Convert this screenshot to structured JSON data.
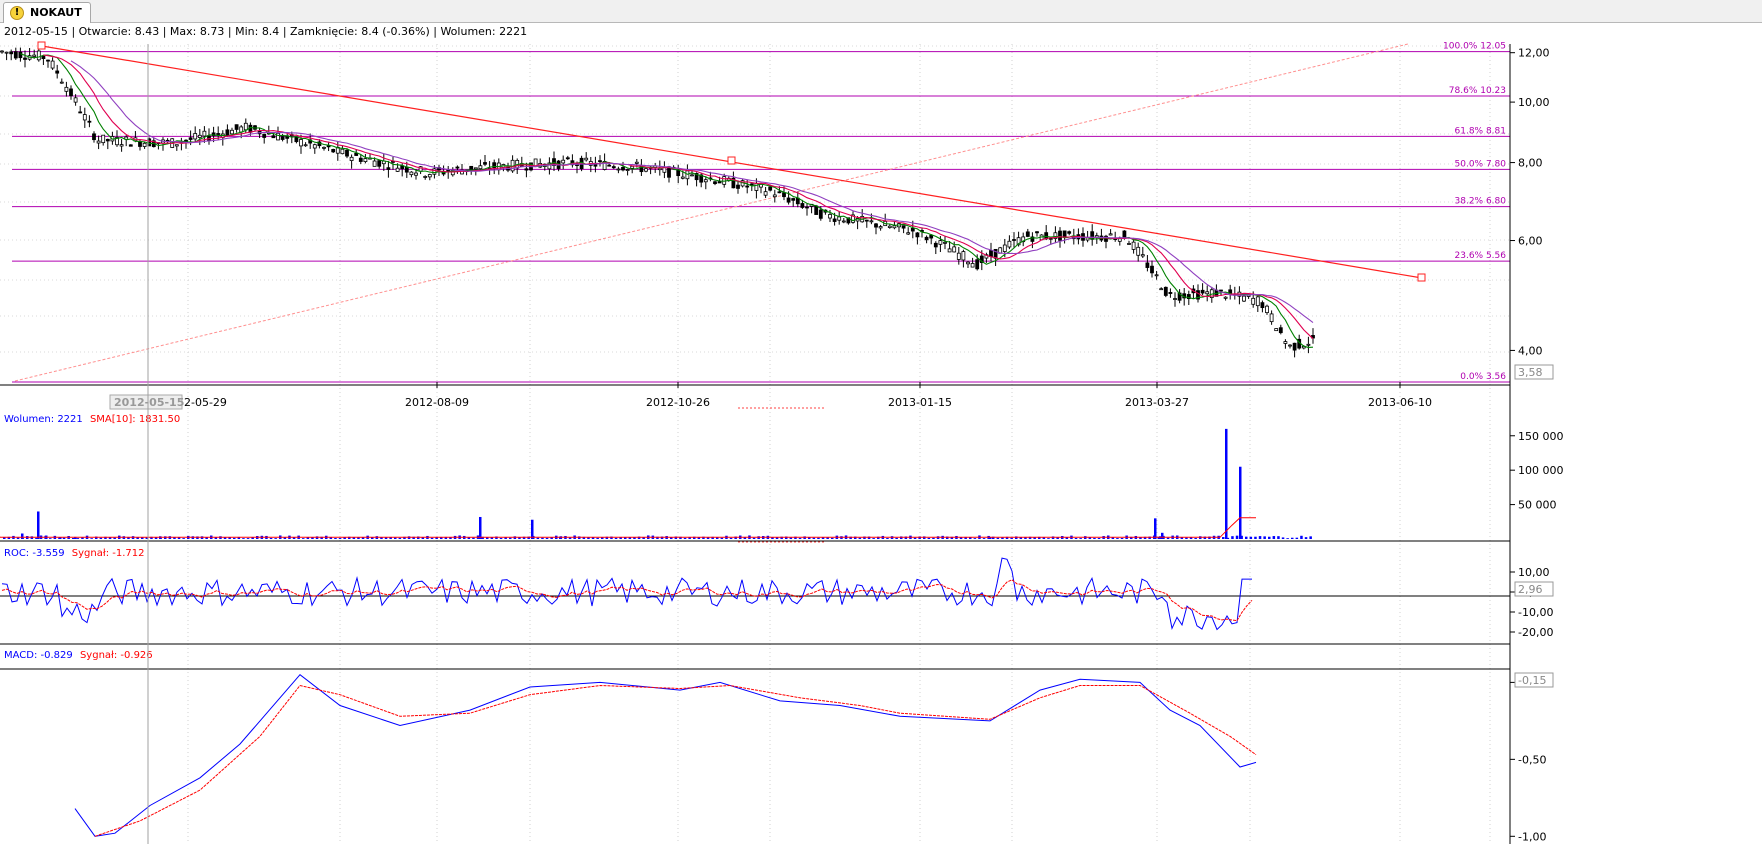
{
  "tab": {
    "label": "NOKAUT",
    "icon": "warning-icon"
  },
  "info": {
    "date": "2012-05-15",
    "open_label": "Otwarcie",
    "open": "8.43",
    "max_label": "Max",
    "max": "8.73",
    "min_label": "Min",
    "min": "8.4",
    "close_label": "Zamknięcie",
    "close": "8.4 (-0.36%)",
    "volume_label": "Wolumen",
    "volume": "2221"
  },
  "fibonacci": [
    {
      "label": "100.0% 12.05",
      "value": 12.05
    },
    {
      "label": "78.6% 10.23",
      "value": 10.23
    },
    {
      "label": "61.8% 8.81",
      "value": 8.81
    },
    {
      "label": "50.0% 7.80",
      "value": 7.8
    },
    {
      "label": "38.2% 6.80",
      "value": 6.8
    },
    {
      "label": "23.6% 5.56",
      "value": 5.56
    },
    {
      "label": "0.0% 3.56",
      "value": 3.56
    }
  ],
  "price_axis": {
    "ticks": [
      "12,00",
      "10,00",
      "8,00",
      "6,00",
      "4,00"
    ],
    "values": [
      12,
      10,
      8,
      6,
      4
    ],
    "last_value": "3,58",
    "scale": "log"
  },
  "date_axis": {
    "labels": [
      "2012-08-09",
      "2012-10-26",
      "2013-01-15",
      "2013-03-27",
      "2013-06-10"
    ],
    "partial_label": "2-05-29",
    "cursor_label": "2012-05-15"
  },
  "volume_panel": {
    "legend_main": "Wolumen: 2221",
    "legend_sma": "SMA[10]: 1831.50",
    "ticks": [
      "150 000",
      "100 000",
      "50 000"
    ],
    "values": [
      150000,
      100000,
      50000
    ]
  },
  "roc_panel": {
    "legend_main": "ROC: -3.559",
    "legend_signal": "Sygnał: -1.712",
    "ticks": [
      "10,00",
      "-0,00",
      "-10,00",
      "-20,00"
    ],
    "values": [
      10,
      0,
      -10,
      -20
    ],
    "last_value": "2,96"
  },
  "macd_panel": {
    "legend_main": "MACD: -0.829",
    "legend_signal": "Sygnał: -0.926",
    "ticks": [
      "0,00",
      "-0,50",
      "-1,00"
    ],
    "values": [
      0,
      -0.5,
      -1.0
    ],
    "last_value": "-0,15"
  },
  "colors": {
    "fib": "#b000b0",
    "trend": "#ff0000",
    "ma_fast": "#008000",
    "ma_mid": "#e00050",
    "ma_slow": "#9040c0",
    "volume": "#0000ff",
    "sma": "#ff0000",
    "indicator": "#0000ff",
    "signal": "#ff0000"
  },
  "chart_data": {
    "type": "candlestick",
    "x_range": [
      "2012-05-02",
      "2013-06-20"
    ],
    "price": {
      "x": [
        "2012-05-02",
        "2012-05-15",
        "2012-05-29",
        "2012-06-20",
        "2012-07-10",
        "2012-08-09",
        "2012-08-30",
        "2012-09-20",
        "2012-10-10",
        "2012-10-26",
        "2012-11-15",
        "2012-12-05",
        "2012-12-20",
        "2013-01-15",
        "2013-02-01",
        "2013-02-15",
        "2013-03-01",
        "2013-03-15",
        "2013-03-27",
        "2013-04-10",
        "2013-04-22",
        "2013-04-30",
        "2013-05-07"
      ],
      "close": [
        12.05,
        11.8,
        8.7,
        8.6,
        9.1,
        8.2,
        7.7,
        7.9,
        8.0,
        7.9,
        7.6,
        7.2,
        6.6,
        6.2,
        5.5,
        6.1,
        6.1,
        6.1,
        4.9,
        4.95,
        4.8,
        4.05,
        4.15
      ],
      "ylim": [
        3.56,
        12.3
      ]
    },
    "fib_levels": [
      12.05,
      10.23,
      8.81,
      7.8,
      6.8,
      5.56,
      3.56
    ],
    "volume": {
      "values": [
        2221,
        8000,
        40000,
        5000,
        2500,
        3000,
        4000,
        32000,
        28000,
        3000,
        3500,
        3000,
        30000,
        4000,
        9000,
        160000,
        105000
      ],
      "sma_last": 31000,
      "ylim": [
        0,
        170000
      ]
    },
    "roc": {
      "last": -3.559,
      "signal_last": -1.712,
      "ylim": [
        -25,
        15
      ]
    },
    "macd": {
      "last": -0.829,
      "signal_last": -0.926,
      "ylim": [
        -1.05,
        0.1
      ]
    }
  }
}
